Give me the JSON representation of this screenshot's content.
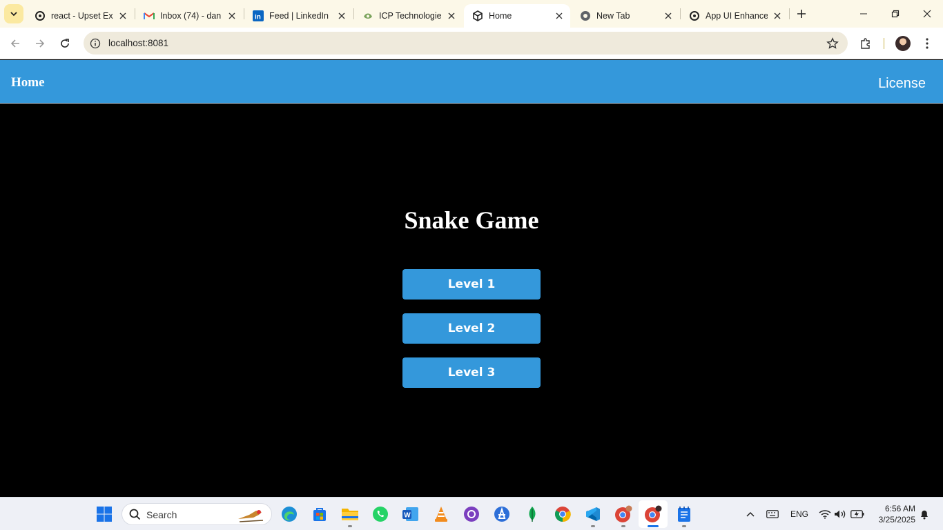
{
  "browser": {
    "tabs": [
      {
        "title": "react - Upset Exp",
        "icon": "openai-icon"
      },
      {
        "title": "Inbox (74) - dan",
        "icon": "gmail-icon"
      },
      {
        "title": "Feed | LinkedIn",
        "icon": "linkedin-icon"
      },
      {
        "title": "ICP Technologies",
        "icon": "icp-icon"
      },
      {
        "title": "Home",
        "icon": "cube-icon",
        "active": true
      },
      {
        "title": "New Tab",
        "icon": "chrome-icon"
      },
      {
        "title": "App UI Enhancer",
        "icon": "openai-icon"
      }
    ],
    "url": "localhost:8081"
  },
  "page": {
    "nav": {
      "home": "Home",
      "license": "License"
    },
    "title": "Snake Game",
    "levels": [
      "Level 1",
      "Level 2",
      "Level 3"
    ]
  },
  "colors": {
    "accent": "#3498db",
    "background": "#000000"
  },
  "taskbar": {
    "search_label": "Search",
    "language": "ENG",
    "time": "6:56 AM",
    "date": "3/25/2025"
  }
}
